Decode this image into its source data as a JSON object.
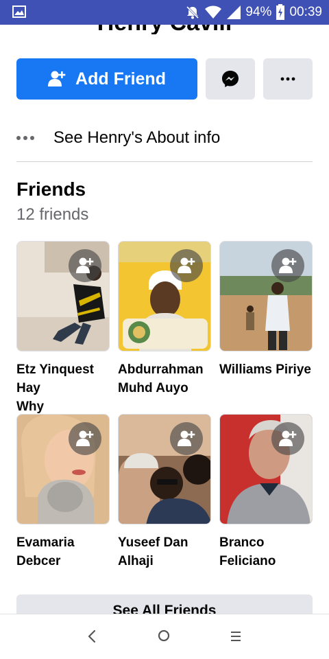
{
  "status_bar": {
    "battery": "94%",
    "time": "00:39",
    "icons": [
      "gallery-icon",
      "mute-icon",
      "wifi-icon",
      "signal-icon",
      "battery-icon"
    ]
  },
  "profile": {
    "name": "Henry Cavill"
  },
  "actions": {
    "add_friend_label": "Add Friend",
    "messenger_icon": "messenger-icon",
    "more_icon": "more-icon"
  },
  "about": {
    "label": "See Henry's About info"
  },
  "friends": {
    "title": "Friends",
    "count": "12 friends",
    "items": [
      {
        "name": "Etz Yinquest Hay\nWhy"
      },
      {
        "name": "Abdurrahman\nMuhd Auyo"
      },
      {
        "name": "Williams Piriye"
      },
      {
        "name": "Evamaria Debcer"
      },
      {
        "name": "Yuseef Dan\nAlhaji"
      },
      {
        "name": "Branco Feliciano"
      }
    ],
    "see_all_label": "See All Friends"
  },
  "navbar": {
    "icons": [
      "back-icon",
      "home-icon",
      "recent-apps-icon"
    ]
  },
  "colors": {
    "accent": "#1877f2",
    "status_bar": "#3f51b5",
    "button_gray": "#e4e6eb"
  }
}
